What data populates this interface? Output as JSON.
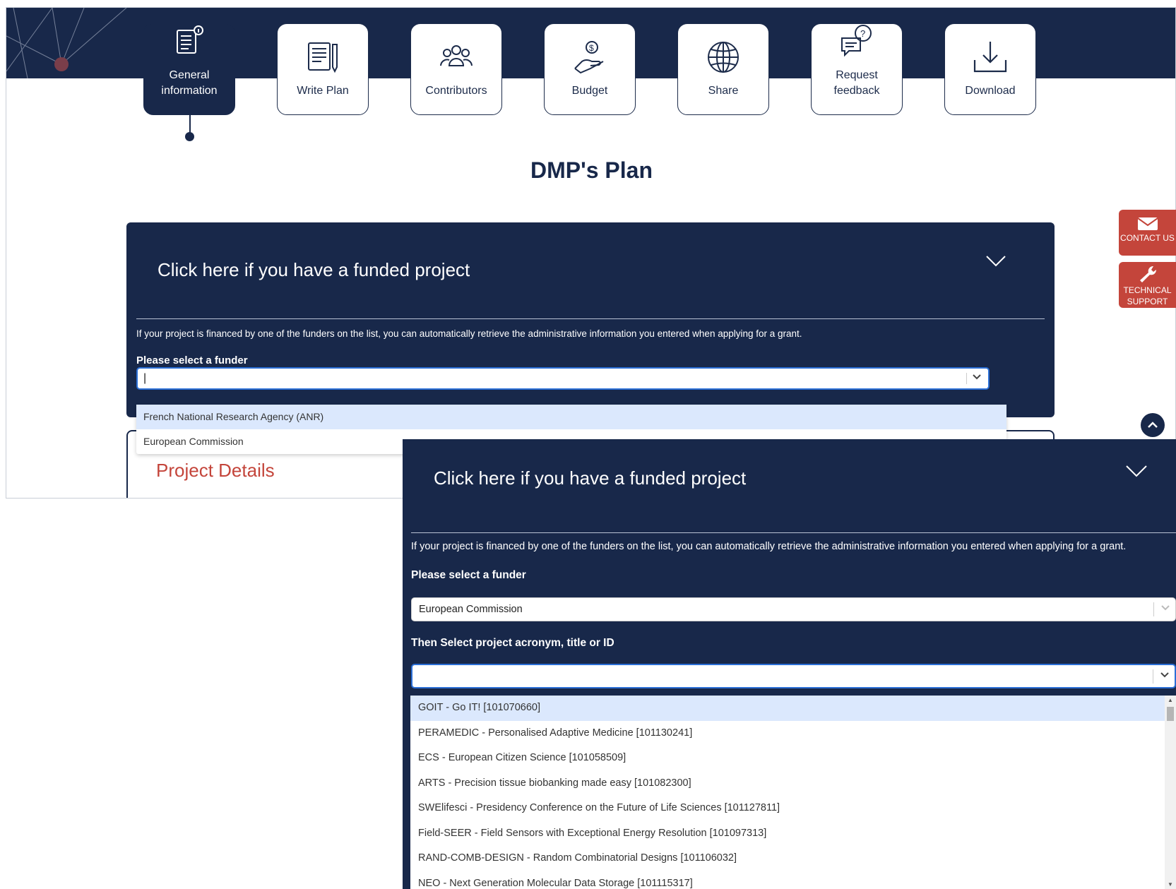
{
  "steps": [
    {
      "label": "General information",
      "icon": "document-info-icon",
      "active": true
    },
    {
      "label": "Write Plan",
      "icon": "write-plan-icon",
      "active": false
    },
    {
      "label": "Contributors",
      "icon": "people-icon",
      "active": false
    },
    {
      "label": "Budget",
      "icon": "money-hand-icon",
      "active": false
    },
    {
      "label": "Share",
      "icon": "globe-icon",
      "active": false
    },
    {
      "label": "Request feedback",
      "icon": "chat-question-icon",
      "active": false
    },
    {
      "label": "Download",
      "icon": "download-icon",
      "active": false
    }
  ],
  "plan_title": "DMP's Plan",
  "funded": {
    "heading": "Click here if you have a funded project",
    "info": "If your project is financed by one of the funders on the list, you can automatically retrieve the administrative information you entered when applying for a grant.",
    "funder_label": "Please select a funder",
    "funder_options": [
      "French National Research Agency (ANR)",
      "European Commission"
    ]
  },
  "project_details": "Project Details",
  "side": {
    "contact": "CONTACT US",
    "support_line1": "TECHNICAL",
    "support_line2": "SUPPORT"
  },
  "second": {
    "heading": "Click here if you have a funded project",
    "info": "If your project is financed by one of the funders on the list, you can automatically retrieve the administrative information you entered when applying for a grant.",
    "funder_label": "Please select a funder",
    "funder_value": "European Commission",
    "project_label": "Then Select project acronym, title or ID",
    "projects": [
      "GOIT - Go IT! [101070660]",
      "PERAMEDIC - Personalised Adaptive Medicine [101130241]",
      "ECS - European Citizen Science [101058509]",
      "ARTS - Precision tissue biobanking made easy [101082300]",
      "SWElifesci - Presidency Conference on the Future of Life Sciences [101127811]",
      "Field-SEER - Field Sensors with Exceptional Energy Resolution [101097313]",
      "RAND-COMB-DESIGN - Random Combinatorial Designs [101106032]",
      "NEO - Next Generation Molecular Data Storage [101115317]"
    ]
  },
  "colors": {
    "navy": "#18284a",
    "accent_red": "#c4453b",
    "highlight": "#dbe8fd"
  }
}
